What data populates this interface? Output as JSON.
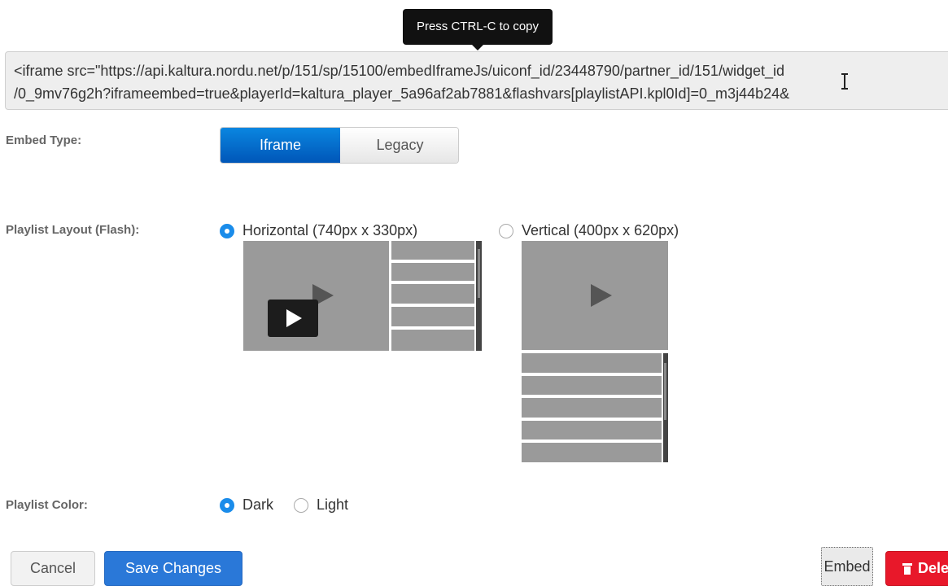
{
  "tooltip": {
    "text": "Press CTRL-C to copy"
  },
  "embed_code": {
    "line1": "<iframe src=\"https://api.kaltura.nordu.net/p/151/sp/15100/embedIframeJs/uiconf_id/23448790/partner_id/151/widget_id",
    "line2": "/0_9mv76g2h?iframeembed=true&playerId=kaltura_player_5a96af2ab7881&flashvars[playlistAPI.kpl0Id]=0_m3j44b24&"
  },
  "embed_type": {
    "label": "Embed Type:",
    "options": [
      "Iframe",
      "Legacy"
    ],
    "selected": "Iframe"
  },
  "playlist_layout": {
    "label": "Playlist Layout (Flash):",
    "options": [
      {
        "label": "Horizontal (740px x 330px)",
        "selected": true
      },
      {
        "label": "Vertical (400px x 620px)",
        "selected": false
      }
    ]
  },
  "playlist_color": {
    "label": "Playlist Color:",
    "options": [
      {
        "label": "Dark",
        "selected": true
      },
      {
        "label": "Light",
        "selected": false
      }
    ]
  },
  "actions": {
    "cancel": "Cancel",
    "save": "Save Changes",
    "embed": "Embed",
    "delete": "Dele"
  },
  "colors": {
    "primary": "#1a8cea",
    "save": "#2a78d8",
    "delete": "#e8182a",
    "thumb_gray": "#9a9a9a"
  }
}
